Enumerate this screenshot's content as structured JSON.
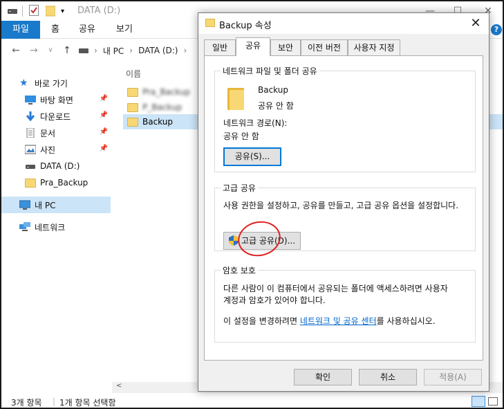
{
  "explorer": {
    "title": "DATA (D:)",
    "ribbon": {
      "file": "파일",
      "home": "홈",
      "share": "공유",
      "view": "보기"
    },
    "address": {
      "pc": "내 PC",
      "drive": "DATA (D:)"
    },
    "nav": {
      "quick_access": "바로 가기",
      "desktop": "바탕 화면",
      "downloads": "다운로드",
      "documents": "문서",
      "pictures": "사진",
      "data_drive": "DATA (D:)",
      "pra_backup": "Pra_Backup",
      "this_pc": "내 PC",
      "network": "네트워크"
    },
    "column_name": "이름",
    "files": [
      "Pra_Backup",
      "P_Backup",
      "Backup"
    ],
    "status": {
      "count": "3개 항목",
      "selected": "1개 항목 선택함"
    }
  },
  "dialog": {
    "title": "Backup 속성",
    "tabs": [
      "일반",
      "공유",
      "보안",
      "이전 버전",
      "사용자 지정"
    ],
    "network_group": {
      "title": "네트워크 파일 및 폴더 공유",
      "folder_name": "Backup",
      "folder_status": "공유 안 함",
      "path_label": "네트워크 경로(N):",
      "path_value": "공유 안 함",
      "share_button": "공유(S)..."
    },
    "advanced_group": {
      "title": "고급 공유",
      "description": "사용 권한을 설정하고, 공유를 만들고, 고급 공유 옵션을 설정합니다.",
      "button": "고급 공유(D)..."
    },
    "password_group": {
      "title": "암호 보호",
      "description_line1": "다른 사람이 이 컴퓨터에서 공유되는 폴더에 액세스하려면 사용자",
      "description_line2": "계정과 암호가 있어야 합니다.",
      "change_prefix": "이 설정을 변경하려면 ",
      "link": "네트워크 및 공유 센터",
      "change_suffix": "를 사용하십시오."
    },
    "buttons": {
      "ok": "확인",
      "cancel": "취소",
      "apply": "적용(A)"
    }
  },
  "colors": {
    "accent": "#1979ca",
    "selection": "#cce4f7",
    "link": "#0066cc",
    "annotation": "#e02020"
  }
}
